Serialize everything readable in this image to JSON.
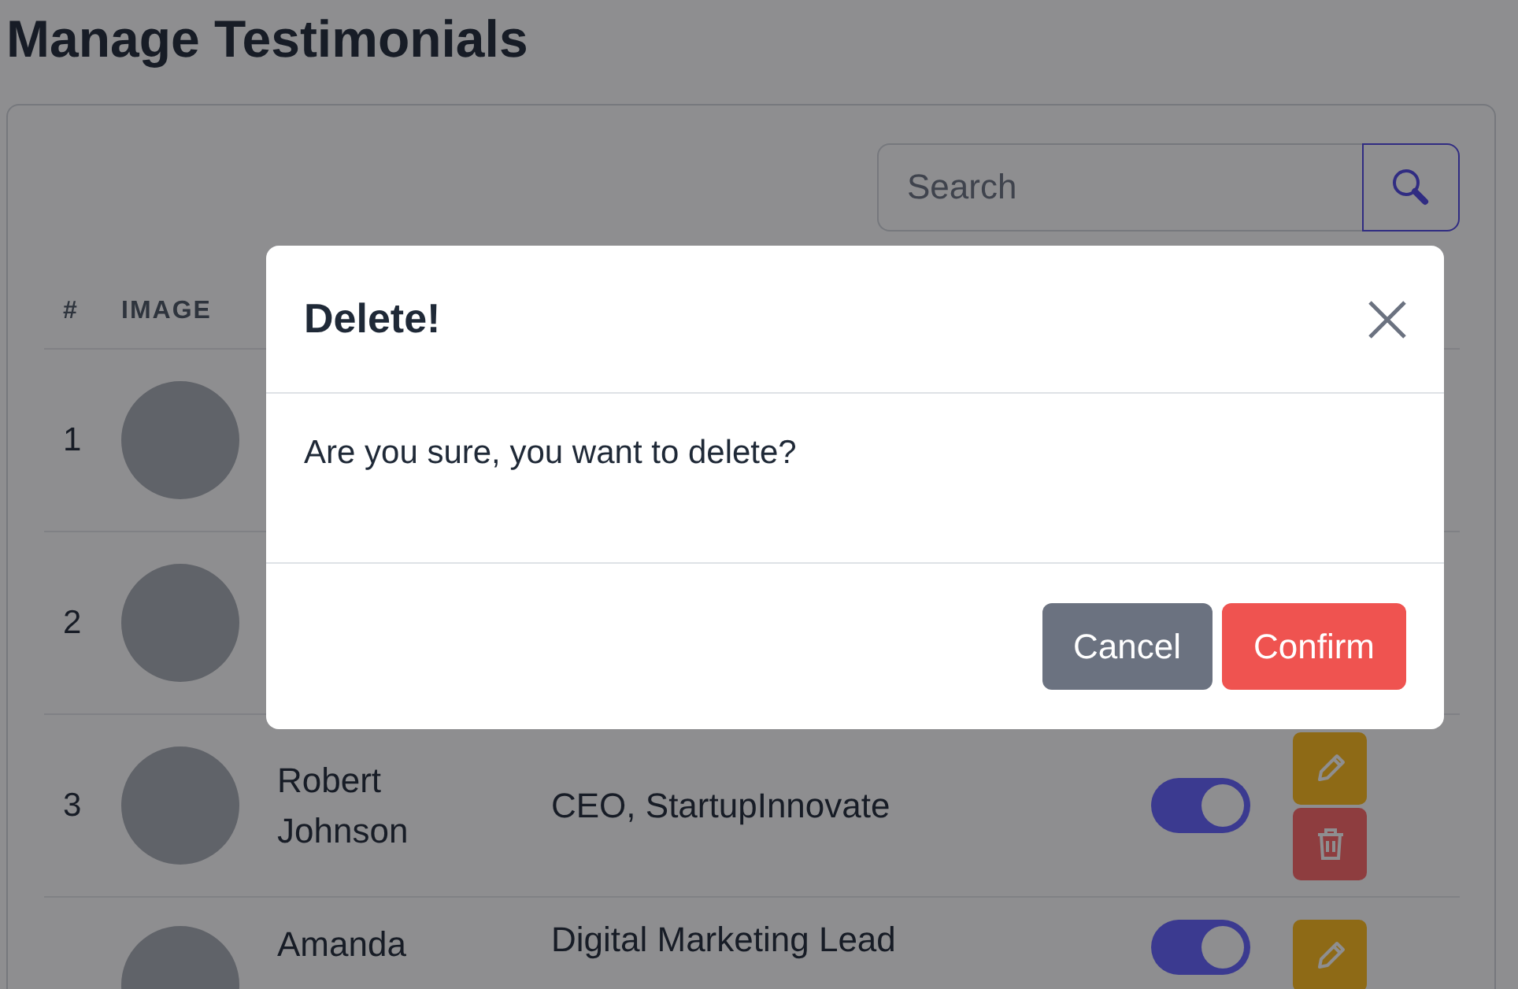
{
  "page": {
    "title": "Manage Testimonials"
  },
  "search": {
    "placeholder": "Search"
  },
  "table": {
    "columns": [
      "#",
      "IMAGE"
    ],
    "rows": [
      {
        "number": "1",
        "active": null
      },
      {
        "number": "2",
        "active": null
      },
      {
        "number": "3",
        "name": "Robert Johnson",
        "position": "CEO, StartupInnovate",
        "active": true
      },
      {
        "name": "Amanda",
        "position": "Digital Marketing Lead",
        "active": true
      }
    ]
  },
  "modal": {
    "title": "Delete!",
    "message": "Are you sure, you want to delete?",
    "buttons": [
      {
        "label": "Cancel",
        "kind": "secondary"
      },
      {
        "label": "Confirm",
        "kind": "danger"
      }
    ]
  }
}
